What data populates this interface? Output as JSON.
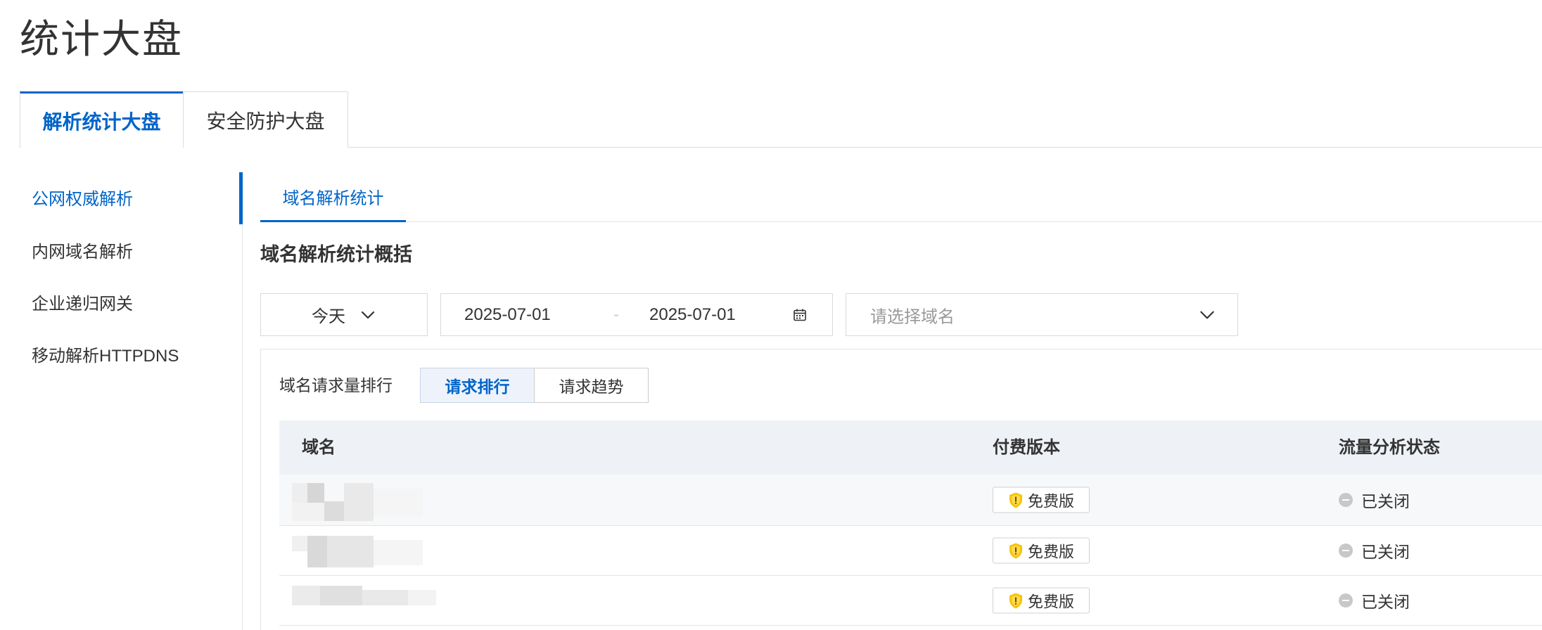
{
  "page_title": "统计大盘",
  "top_tabs": [
    {
      "label": "解析统计大盘",
      "active": true
    },
    {
      "label": "安全防护大盘",
      "active": false
    }
  ],
  "sidebar": {
    "items": [
      {
        "label": "公网权威解析",
        "active": true
      },
      {
        "label": "内网域名解析",
        "active": false
      },
      {
        "label": "企业递归网关",
        "active": false
      },
      {
        "label": "移动解析HTTPDNS",
        "active": false
      }
    ]
  },
  "sub_tabs": [
    {
      "label": "域名解析统计",
      "active": true
    }
  ],
  "section_title": "域名解析统计概括",
  "filters": {
    "period_select": {
      "value": "今天",
      "icon": "chevron-down-icon"
    },
    "date_range": {
      "start": "2025-07-01",
      "separator": "-",
      "end": "2025-07-01",
      "icon": "calendar-icon"
    },
    "domain_select": {
      "placeholder": "请选择域名",
      "icon": "chevron-down-icon"
    }
  },
  "ranking": {
    "label": "域名请求量排行",
    "toggle": [
      {
        "label": "请求排行",
        "active": true
      },
      {
        "label": "请求趋势",
        "active": false
      }
    ]
  },
  "table": {
    "columns": {
      "domain": "域名",
      "version": "付费版本",
      "traffic_status": "流量分析状态"
    },
    "rows": [
      {
        "version": "免费版",
        "version_icon": "shield-icon",
        "status": "已关闭",
        "status_icon": "disabled-dot-icon"
      },
      {
        "version": "免费版",
        "version_icon": "shield-icon",
        "status": "已关闭",
        "status_icon": "disabled-dot-icon"
      },
      {
        "version": "免费版",
        "version_icon": "shield-icon",
        "status": "已关闭",
        "status_icon": "disabled-dot-icon"
      }
    ]
  },
  "colors": {
    "accent": "#0064c8",
    "text": "#333333",
    "muted": "#999999",
    "border": "#dddddd",
    "table_header_bg": "#eef1f6",
    "badge_icon": "#f5c400",
    "status_off": "#c8c8c8"
  }
}
